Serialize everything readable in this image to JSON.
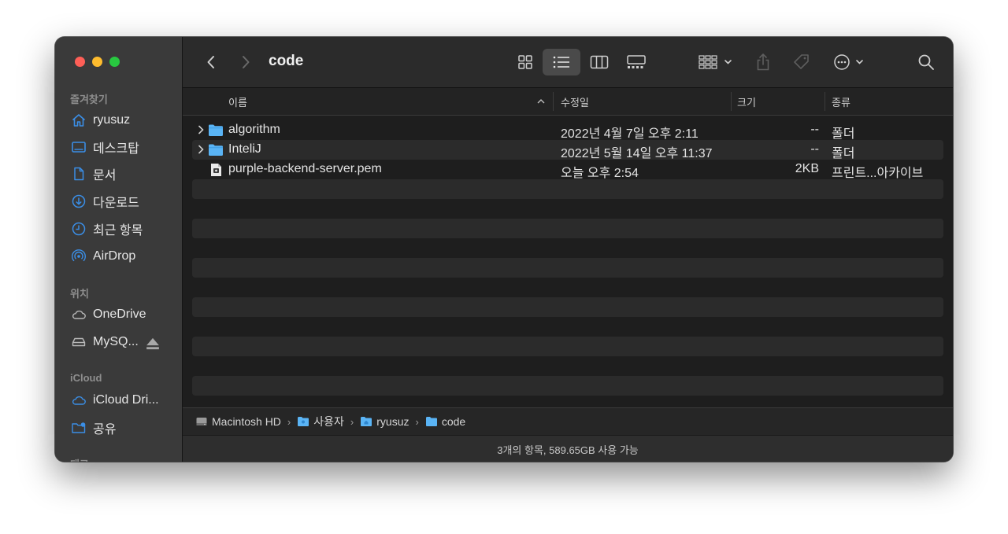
{
  "window": {
    "title": "code"
  },
  "sidebar": {
    "sections": {
      "favorites": "즐겨찾기",
      "locations": "위치",
      "icloud": "iCloud",
      "tags": "태그"
    },
    "favorites": [
      {
        "label": "ryusuz",
        "icon": "home-icon"
      },
      {
        "label": "데스크탑",
        "icon": "desktop-icon"
      },
      {
        "label": "문서",
        "icon": "document-icon"
      },
      {
        "label": "다운로드",
        "icon": "download-icon"
      },
      {
        "label": "최근 항목",
        "icon": "clock-icon"
      },
      {
        "label": "AirDrop",
        "icon": "airdrop-icon"
      }
    ],
    "locations": [
      {
        "label": "OneDrive",
        "icon": "cloud-icon"
      },
      {
        "label": "MySQ...",
        "icon": "drive-icon"
      }
    ],
    "icloud": [
      {
        "label": "iCloud Dri...",
        "icon": "cloud-icon"
      },
      {
        "label": "공유",
        "icon": "shared-folder-icon"
      }
    ]
  },
  "columns": {
    "name": "이름",
    "modified": "수정일",
    "size": "크기",
    "kind": "종류"
  },
  "files": [
    {
      "name": "algorithm",
      "modified": "2022년 4월 7일 오후 2:11",
      "size": "--",
      "kind": "폴더",
      "type": "folder"
    },
    {
      "name": "InteliJ",
      "modified": "2022년 5월 14일 오후 11:37",
      "size": "--",
      "kind": "폴더",
      "type": "folder"
    },
    {
      "name": "purple-backend-server.pem",
      "modified": "오늘 오후 2:54",
      "size": "2KB",
      "kind": "프린트...아카이브",
      "type": "file"
    }
  ],
  "pathbar": [
    "Macintosh HD",
    "사용자",
    "ryusuz",
    "code"
  ],
  "status": "3개의 항목, 589.65GB 사용 가능",
  "colors": {
    "accent": "#0a84ff",
    "folder": "#5ab4f5",
    "close": "#fe5f57",
    "minimize": "#febc2e",
    "maximize": "#28c840"
  }
}
